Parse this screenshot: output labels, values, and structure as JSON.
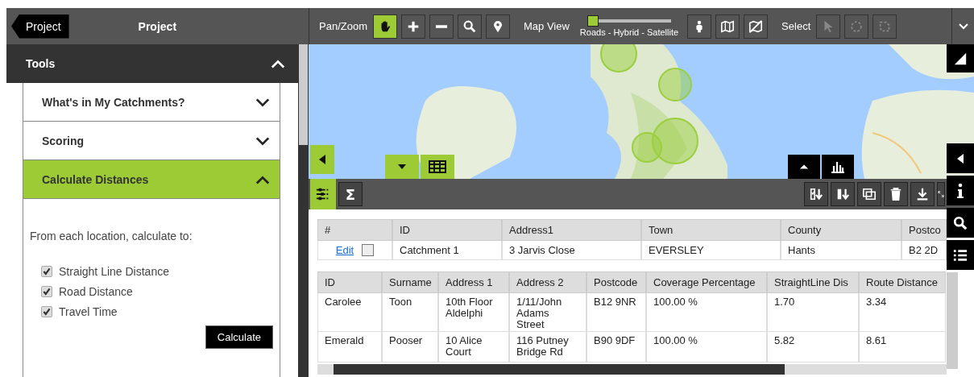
{
  "sidebar": {
    "back_button": "Project",
    "title": "Project",
    "tools": {
      "label": "Tools",
      "expanded": true
    },
    "sections": [
      {
        "label": "What's in My Catchments?",
        "expanded": false
      },
      {
        "label": "Scoring",
        "expanded": false
      },
      {
        "label": "Calculate Distances",
        "expanded": true
      }
    ],
    "calculate": {
      "prompt": "From each location, calculate to:",
      "options": [
        {
          "label": "Straight Line Distance",
          "checked": true
        },
        {
          "label": "Road Distance",
          "checked": true
        },
        {
          "label": "Travel Time",
          "checked": true
        }
      ],
      "button": "Calculate"
    }
  },
  "toolbar": {
    "pan_zoom_label": "Pan/Zoom",
    "pan_tools": [
      {
        "kind": "hand",
        "selected": true
      },
      {
        "kind": "plus",
        "selected": false
      },
      {
        "kind": "minus",
        "selected": false
      },
      {
        "kind": "search",
        "selected": false
      },
      {
        "kind": "pin",
        "selected": false
      }
    ],
    "map_view_label": "Map View",
    "map_view": {
      "level": 0,
      "caption": "Roads - Hybrid - Satellite"
    },
    "map_tools": [
      {
        "kind": "person"
      },
      {
        "kind": "map"
      },
      {
        "kind": "nomap"
      }
    ],
    "select_label": "Select",
    "select_tools": [
      {
        "kind": "arrow",
        "disabled": true
      },
      {
        "kind": "circle",
        "disabled": true
      },
      {
        "kind": "lasso",
        "disabled": true
      }
    ]
  },
  "catchment_table": {
    "columns": [
      "#",
      "ID",
      "Address1",
      "Town",
      "County",
      "Postco"
    ],
    "rows": [
      {
        "checked": false,
        "cells": [
          "Edit",
          "Catchment 1",
          "3 Jarvis Close",
          "EVERSLEY",
          "Hants",
          "B2 2D"
        ]
      }
    ]
  },
  "detail_table": {
    "columns": [
      "ID",
      "Surname",
      "Address 1",
      "Address 2",
      "Postcode",
      "Coverage Percentage",
      "StraightLine Dis",
      "Route Distance"
    ],
    "rows": [
      [
        "Carolee",
        "Toon",
        "10th Floor Aldelphi",
        "1/11/John Adams Street",
        "B12 9NR",
        "100.00 %",
        "1.70",
        "3.34"
      ],
      [
        "Emerald",
        "Pooser",
        "10 Alice Court",
        "116 Putney Bridge Rd",
        "B90 9DF",
        "100.00 %",
        "5.82",
        "8.61"
      ]
    ]
  },
  "grid_actions": {
    "sum_button": "Σ"
  }
}
